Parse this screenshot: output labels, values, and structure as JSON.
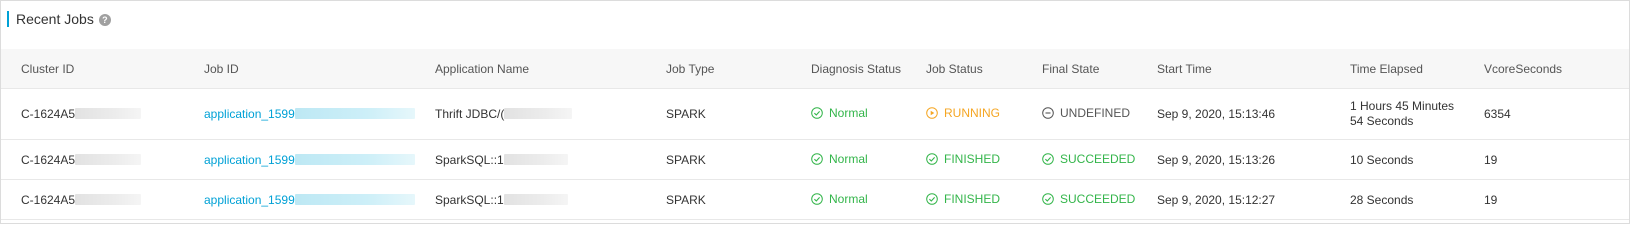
{
  "panel": {
    "title": "Recent Jobs",
    "help_glyph": "?"
  },
  "columns": {
    "cluster_id": "Cluster ID",
    "job_id": "Job ID",
    "application_name": "Application Name",
    "job_type": "Job Type",
    "diagnosis_status": "Diagnosis Status",
    "job_status": "Job Status",
    "final_state": "Final State",
    "start_time": "Start Time",
    "time_elapsed": "Time Elapsed",
    "vcore_seconds": "VcoreSeconds"
  },
  "rows": [
    {
      "cluster_id": "C-1624A5",
      "job_id": "application_1599",
      "application_name": "Thrift JDBC/(",
      "job_type": "SPARK",
      "diagnosis_status": "Normal",
      "job_status": "RUNNING",
      "final_state": "UNDEFINED",
      "start_time": "Sep 9, 2020, 15:13:46",
      "time_elapsed_line1": "1 Hours 45 Minutes",
      "time_elapsed_line2": "54 Seconds",
      "vcore_seconds": "6354"
    },
    {
      "cluster_id": "C-1624A5",
      "job_id": "application_1599",
      "application_name": "SparkSQL::1",
      "job_type": "SPARK",
      "diagnosis_status": "Normal",
      "job_status": "FINISHED",
      "final_state": "SUCCEEDED",
      "start_time": "Sep 9, 2020, 15:13:26",
      "time_elapsed": "10 Seconds",
      "vcore_seconds": "19"
    },
    {
      "cluster_id": "C-1624A5",
      "job_id": "application_1599",
      "application_name": "SparkSQL::1",
      "job_type": "SPARK",
      "diagnosis_status": "Normal",
      "job_status": "FINISHED",
      "final_state": "SUCCEEDED",
      "start_time": "Sep 9, 2020, 15:12:27",
      "time_elapsed": "28 Seconds",
      "vcore_seconds": "19"
    }
  ],
  "colors": {
    "accent": "#00a1d6",
    "success": "#33b54a",
    "running": "#f5a623",
    "undefined": "#555555"
  },
  "icons": {
    "help": "question-circle-icon",
    "normal": "check-circle-icon",
    "running": "play-circle-icon",
    "finished": "check-circle-icon",
    "undefined": "minus-circle-icon",
    "succeeded": "check-circle-icon"
  }
}
